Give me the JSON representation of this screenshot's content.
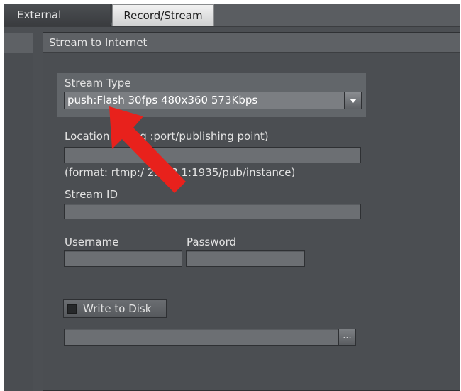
{
  "tabs": {
    "external": "External",
    "record_stream": "Record/Stream"
  },
  "panel": {
    "title": "Stream to Internet"
  },
  "stream_type": {
    "label": "Stream Type",
    "value": "push:Flash 30fps 480x360 573Kbps"
  },
  "location": {
    "label": "Location (i      ding :port/publishing point)",
    "value": "",
    "hint": "(format: rtmp:/      2.168.1:1935/pub/instance)"
  },
  "stream_id": {
    "label": "Stream ID",
    "value": ""
  },
  "username": {
    "label": "Username",
    "value": ""
  },
  "password": {
    "label": "Password",
    "value": ""
  },
  "write_to_disk": {
    "label": "Write to Disk",
    "checked": false,
    "path": "",
    "browse_label": "..."
  },
  "colors": {
    "annotation_arrow": "#e8211c"
  }
}
